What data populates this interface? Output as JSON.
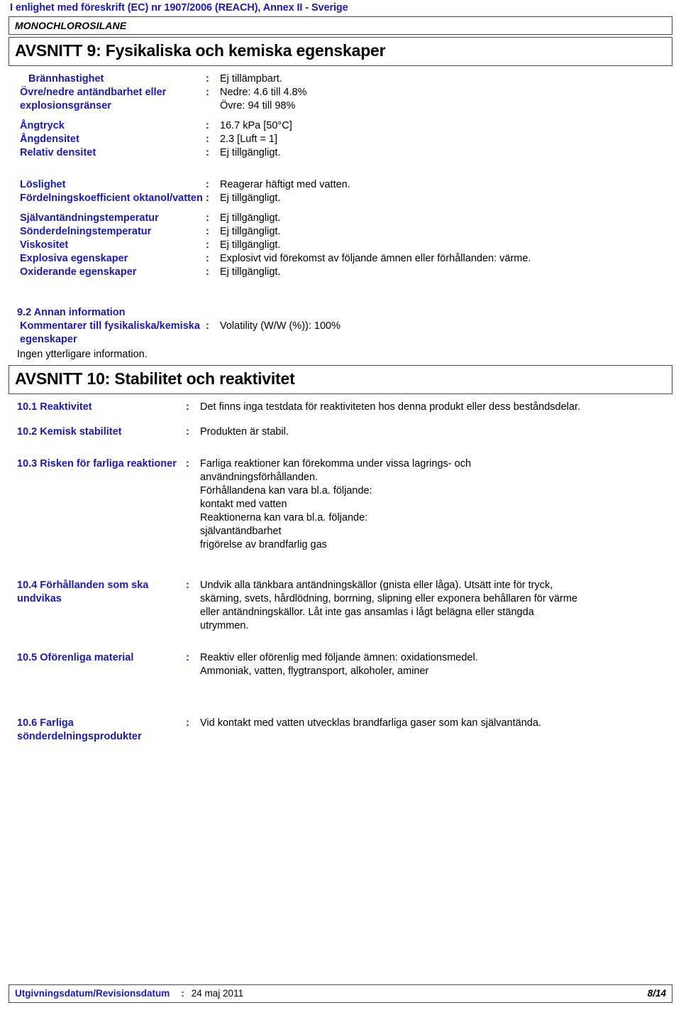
{
  "document": {
    "running_header": "I enlighet med föreskrift (EC) nr 1907/2006 (REACH), Annex II - Sverige",
    "product_name": "MONOCHLOROSILANE",
    "colon": ":",
    "accent_color": "#1a1ab8",
    "text_color": "#000000"
  },
  "section9": {
    "heading": "AVSNITT 9: Fysikaliska och kemiska egenskaper",
    "rows": [
      {
        "label": "Brännhastighet",
        "value": "Ej tillämpbart."
      },
      {
        "label": "Övre/nedre antändbarhet eller explosionsgränser",
        "value": "Nedre: 4.6 till 4.8%\nÖvre: 94 till 98%"
      },
      {
        "label": "Ångtryck",
        "value": "16.7 kPa [50°C]"
      },
      {
        "label": "Ångdensitet",
        "value": "2.3 [Luft = 1]"
      },
      {
        "label": "Relativ densitet",
        "value": "Ej tillgängligt."
      },
      {
        "label": "Löslighet",
        "value": "Reagerar häftigt med vatten."
      },
      {
        "label": "Fördelningskoefficient oktanol/vatten",
        "value": "Ej tillgängligt."
      },
      {
        "label": "Självantändningstemperatur",
        "value": "Ej tillgängligt."
      },
      {
        "label": "Sönderdelningstemperatur",
        "value": "Ej tillgängligt."
      },
      {
        "label": "Viskositet",
        "value": "Ej tillgängligt."
      },
      {
        "label": "Explosiva egenskaper",
        "value": "Explosivt vid förekomst av följande ämnen eller förhållanden: värme."
      },
      {
        "label": "Oxiderande egenskaper",
        "value": "Ej tillgängligt."
      }
    ]
  },
  "section9_2": {
    "heading": "9.2 Annan information",
    "comment_label": "Kommentarer till fysikaliska/kemiska egenskaper",
    "comment_value": "Volatility (W/W (%)): 100%",
    "note": "Ingen ytterligare information."
  },
  "section10": {
    "heading": "AVSNITT 10: Stabilitet och reaktivitet",
    "rows": [
      {
        "label": "10.1 Reaktivitet",
        "value": "Det finns inga testdata för reaktiviteten hos denna produkt eller dess beståndsdelar."
      },
      {
        "label": "10.2 Kemisk stabilitet",
        "value": "Produkten är stabil."
      },
      {
        "label": "10.3 Risken för farliga reaktioner",
        "value": "Farliga reaktioner kan förekomma under vissa lagrings- och\nanvändningsförhållanden.\nFörhållandena kan vara bl.a. följande:\nkontakt med vatten\nReaktionerna kan vara bl.a. följande:\nsjälvantändbarhet\nfrigörelse av brandfarlig gas"
      },
      {
        "label": "10.4 Förhållanden som ska undvikas",
        "value": "Undvik alla tänkbara antändningskällor (gnista eller låga).  Utsätt inte för tryck,\nskärning, svets, hårdlödning, borrning, slipning eller exponera behållaren för värme\neller antändningskällor.  Låt inte gas ansamlas i lågt belägna eller stängda\nutrymmen."
      },
      {
        "label": "10.5 Oförenliga material",
        "value": "Reaktiv eller oförenlig med följande ämnen: oxidationsmedel.\nAmmoniak, vatten, flygtransport, alkoholer, aminer"
      },
      {
        "label": "10.6 Farliga sönderdelningsprodukter",
        "value": "Vid kontakt med vatten utvecklas brandfarliga gaser som kan självantända."
      }
    ]
  },
  "footer": {
    "label": "Utgivningsdatum/Revisionsdatum",
    "date": "24 maj 2011",
    "page": "8/14"
  }
}
